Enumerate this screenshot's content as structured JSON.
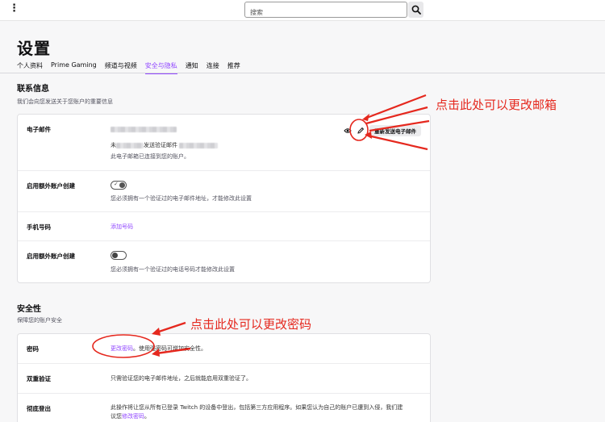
{
  "topbar": {
    "search_placeholder": "搜索"
  },
  "header": {
    "title": "设置",
    "tabs": [
      {
        "label": "个人资料",
        "active": false
      },
      {
        "label": "Prime Gaming",
        "active": false
      },
      {
        "label": "频道与视频",
        "active": false
      },
      {
        "label": "安全与隐私",
        "active": true
      },
      {
        "label": "通知",
        "active": false
      },
      {
        "label": "连接",
        "active": false
      },
      {
        "label": "推荐",
        "active": false
      }
    ]
  },
  "contact": {
    "title": "联系信息",
    "subtitle": "我们会向您发送关于您账户的重要信息",
    "email_label": "电子邮件",
    "unverified_prefix": "未",
    "unverified_mid": "发送验证邮件",
    "connected_note": "此电子邮箱已连接到您的账户。",
    "resend_button": "重新发送电子邮件",
    "extra_account_label": "启用额外账户创建",
    "extra_account_note_email": "您必须拥有一个验证过的电子邮件地址，才能修改此设置",
    "phone_label": "手机号码",
    "add_phone_link": "添加号码",
    "extra_account_label_2": "启用额外账户创建",
    "extra_account_note_phone": "您必须拥有一个验证过的电话号码才能修改此设置"
  },
  "security": {
    "title": "安全性",
    "subtitle": "保障您的账户安全",
    "password_label": "密码",
    "change_password_link": "更改密码",
    "password_note": "。使用强密码可增加安全性。",
    "twofa_label": "双重验证",
    "twofa_note": "只需验证您的电子邮件地址，之后就能启用双重验证了。",
    "logout_label": "彻底登出",
    "logout_note_1": "此操作将让您从所有已登录 Twitch 的设备中登出，包括第三方应用程序。如果您认为自己的账户已遭到入侵，我们建",
    "logout_note_2": "议您",
    "logout_link": "修改密码",
    "logout_note_3": "。"
  },
  "annotations": {
    "email_hint": "点击此处可以更改邮箱",
    "password_hint": "点击此处可以更改密码"
  },
  "colors": {
    "accent": "#9147ff",
    "annotation": "#e5281e"
  },
  "icons": {
    "menu": "kebab-icon",
    "search": "search-icon",
    "visibility": "eye-icon",
    "edit": "pencil-icon"
  }
}
